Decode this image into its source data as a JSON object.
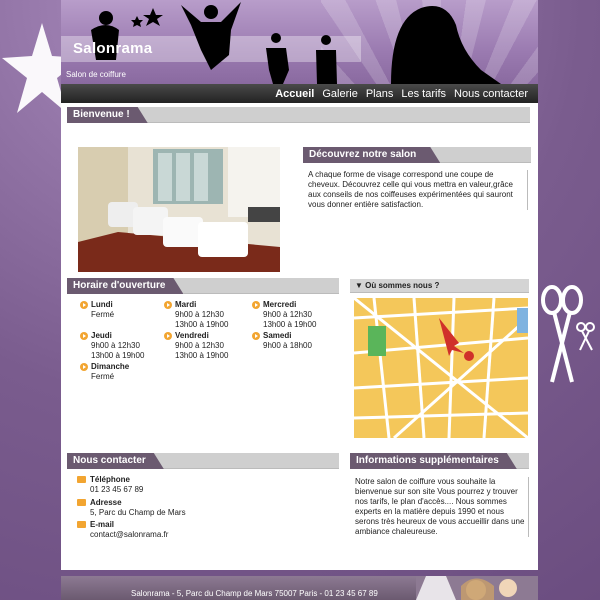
{
  "header": {
    "title": "Salonrama",
    "subtitle": "Salon de coiffure"
  },
  "nav": {
    "items": [
      "Accueil",
      "Galerie",
      "Plans",
      "Les tarifs",
      "Nous contacter"
    ],
    "active": "Accueil"
  },
  "welcome": {
    "heading": "Bienvenue !"
  },
  "discover": {
    "heading": "Découvrez notre salon",
    "text": "A chaque forme de visage correspond une coupe de cheveux. Découvrez celle qui vous mettra en valeur,grâce aux conseils de nos coiffeuses expérimentées qui sauront vous donner entière satisfaction."
  },
  "hours": {
    "heading": "Horaire d'ouverture",
    "days": [
      {
        "day": "Lundi",
        "hours": "Fermé"
      },
      {
        "day": "Mardi",
        "hours": "9h00 à 12h30\n13h00 à 19h00"
      },
      {
        "day": "Mercredi",
        "hours": "9h00 à 12h30\n13h00 à 19h00"
      },
      {
        "day": "Jeudi",
        "hours": "9h00 à 12h30\n13h00 à 19h00"
      },
      {
        "day": "Vendredi",
        "hours": "9h00 à 12h30\n13h00 à 19h00"
      },
      {
        "day": "Samedi",
        "hours": "9h00 à 18h00"
      },
      {
        "day": "Dimanche",
        "hours": "Fermé"
      }
    ]
  },
  "map": {
    "heading": "▼ Où sommes nous ?"
  },
  "contact": {
    "heading": "Nous contacter",
    "items": [
      {
        "label": "Téléphone",
        "value": "01 23 45 67 89",
        "icon": "phone-icon"
      },
      {
        "label": "Adresse",
        "value": "5, Parc du Champ de Mars",
        "icon": "house-icon"
      },
      {
        "label": "E-mail",
        "value": "contact@salonrama.fr",
        "icon": "mail-icon"
      }
    ]
  },
  "info": {
    "heading": "Informations supplémentaires",
    "text": "Notre salon de coiffure vous souhaite la bienvenue sur son site Vous pourrez y trouver nos tarifs, le plan d'accès.... Nous sommes experts en la matière depuis 1990 et nous serons très heureux de vous accueillir dans une ambiance chaleureuse."
  },
  "footer": {
    "text": "Salonrama - 5, Parc du Champ de Mars 75007 Paris - 01 23 45 67 89"
  },
  "colors": {
    "accent": "#f2a531",
    "tab": "#6b5a70",
    "background": "#7a5c8e"
  }
}
